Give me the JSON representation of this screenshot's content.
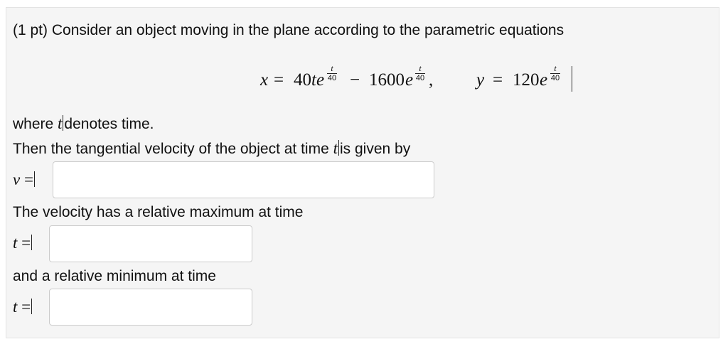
{
  "problem": {
    "intro": "(1 pt) Consider an object moving in the plane according to the parametric equations",
    "equation": {
      "x_lhs": "x",
      "eq1": "=",
      "x_term1_coeff": "40",
      "x_term1_var": "te",
      "x_exp1_num": "t",
      "x_exp1_den": "40",
      "minus": "−",
      "x_term2_coeff": "1600",
      "x_term2_var": "e",
      "x_exp2_num": "t",
      "x_exp2_den": "40",
      "comma": ",",
      "y_lhs": "y",
      "eq2": "=",
      "y_coeff": "120",
      "y_var": "e",
      "y_exp_num": "t",
      "y_exp_den": "40"
    },
    "where_pre": "where ",
    "where_var": "t",
    "where_post": "denotes time.",
    "then_pre": "Then the tangential velocity of the object at time ",
    "then_var": "t",
    "then_post": "is given by",
    "v_label": "v",
    "equals": "=",
    "velocity_max_text": "The velocity has a relative maximum at time",
    "t_label": "t",
    "relative_min_text": "and a relative minimum at time",
    "inputs": {
      "v_value": "",
      "tmax_value": "",
      "tmin_value": ""
    }
  }
}
